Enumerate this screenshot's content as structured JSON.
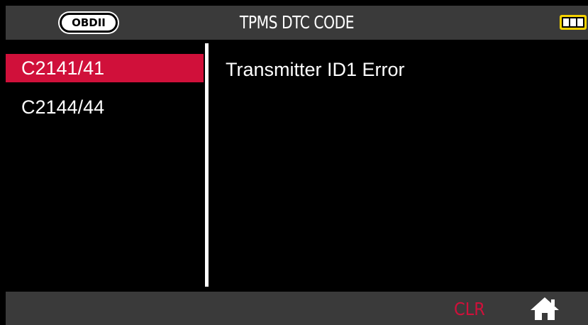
{
  "header": {
    "badge": "OBDII",
    "title": "TPMS DTC CODE",
    "battery_icon": "battery-full-icon",
    "battery_color": "#f5d200"
  },
  "codes": [
    {
      "code": "C2141/41",
      "selected": true
    },
    {
      "code": "C2144/44",
      "selected": false
    }
  ],
  "detail": {
    "description": "Transmitter ID1 Error"
  },
  "footer": {
    "clr_label": "CLR",
    "home_icon": "home-icon"
  },
  "colors": {
    "accent": "#d0103a",
    "bar_background": "#3a3a3a",
    "screen_background": "#000000"
  }
}
